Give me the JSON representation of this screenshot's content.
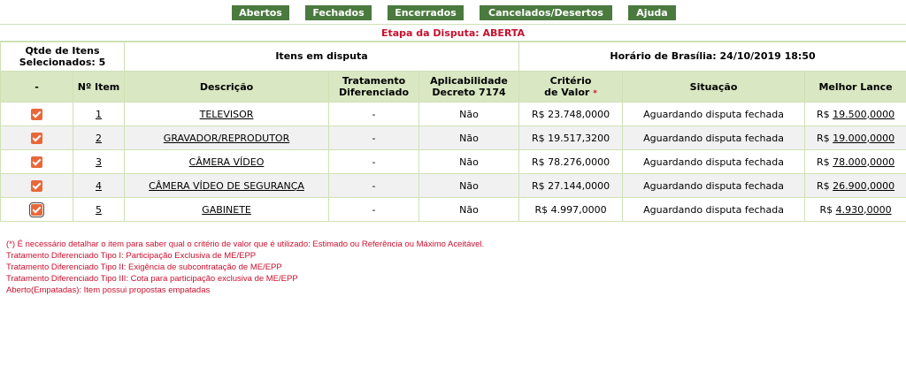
{
  "tabs": [
    "Abertos",
    "Fechados",
    "Encerrados",
    "Cancelados/Desertos",
    "Ajuda"
  ],
  "stage_label": "Etapa da Disputa: ABERTA",
  "summary": {
    "qtd_label_1": "Qtde de Itens",
    "qtd_label_2": "Selecionados: 5",
    "itens_em_disputa": "Itens em disputa",
    "horario": "Horário de Brasília: 24/10/2019 18:50"
  },
  "headers": {
    "sel": "-",
    "num": "Nº Item",
    "descricao": "Descrição",
    "tratamento_1": "Tratamento",
    "tratamento_2": "Diferenciado",
    "aplic_1": "Aplicabilidade",
    "aplic_2": "Decreto 7174",
    "criterio_1": "Critério",
    "criterio_2": "de Valor",
    "criterio_star": "*",
    "situacao": "Situação",
    "melhor_lance": "Melhor Lance"
  },
  "items": [
    {
      "num": "1",
      "descricao": "TELEVISOR",
      "tratamento": "-",
      "aplic": "Não",
      "criterio": "R$ 23.748,0000",
      "situacao": "Aguardando disputa fechada",
      "lance_prefix": "R$ ",
      "lance": "19.500,0000"
    },
    {
      "num": "2",
      "descricao": "GRAVADOR/REPRODUTOR",
      "tratamento": "-",
      "aplic": "Não",
      "criterio": "R$ 19.517,3200",
      "situacao": "Aguardando disputa fechada",
      "lance_prefix": "R$ ",
      "lance": "19.000,0000"
    },
    {
      "num": "3",
      "descricao": "CÂMERA VÍDEO",
      "tratamento": "-",
      "aplic": "Não",
      "criterio": "R$ 78.276,0000",
      "situacao": "Aguardando disputa fechada",
      "lance_prefix": "R$ ",
      "lance": "78.000,0000"
    },
    {
      "num": "4",
      "descricao": "CÂMERA VÍDEO DE SEGURANÇA",
      "tratamento": "-",
      "aplic": "Não",
      "criterio": "R$ 27.144,0000",
      "situacao": "Aguardando disputa fechada",
      "lance_prefix": "R$ ",
      "lance": "26.900,0000"
    },
    {
      "num": "5",
      "descricao": "GABINETE",
      "tratamento": "-",
      "aplic": "Não",
      "criterio": "R$ 4.997,0000",
      "situacao": "Aguardando disputa fechada",
      "lance_prefix": "R$ ",
      "lance": "4.930,0000"
    }
  ],
  "notes": [
    "(*) É necessário detalhar o item para saber qual o critério de valor que é utilizado: Estimado ou Referência ou Máximo Aceitável.",
    "Tratamento Diferenciado Tipo I: Participação Exclusiva de ME/EPP",
    "Tratamento Diferenciado Tipo II: Exigência de subcontratação de ME/EPP",
    "Tratamento Diferenciado Tipo III: Cota para participação exclusiva de ME/EPP",
    "Aberto(Empatadas): Item possui propostas empatadas"
  ],
  "colors": {
    "tab_bg": "#4a7a3e",
    "header_bg": "#d9e8c2",
    "accent_red": "#c8102e",
    "checkbox": "#e8683a"
  }
}
